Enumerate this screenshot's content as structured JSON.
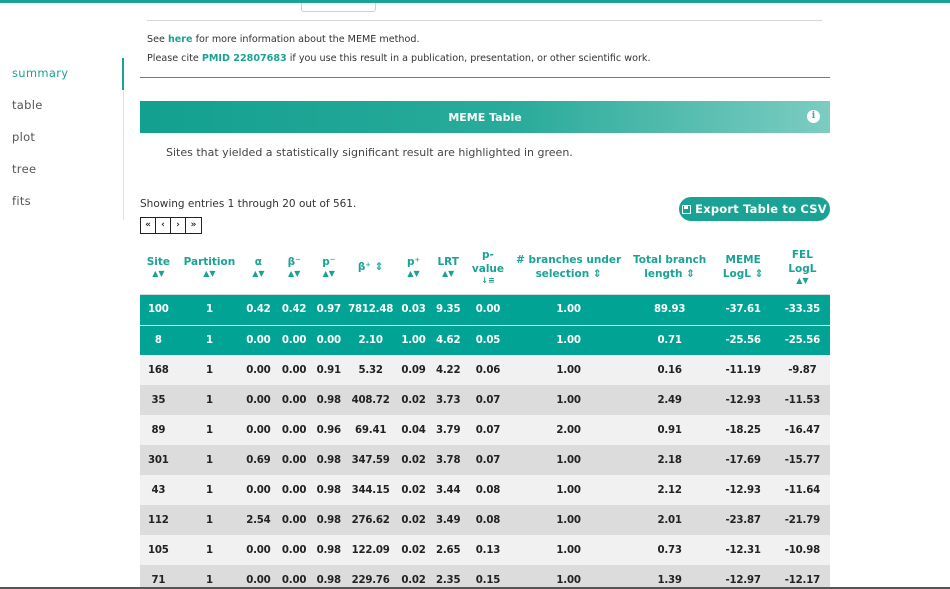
{
  "info": {
    "line1_prefix": "See ",
    "line1_link": "here",
    "line1_suffix": " for more information about the MEME method.",
    "line2_prefix": "Please cite ",
    "line2_link": "PMID 22807683",
    "line2_suffix": " if you use this result in a publication, presentation, or other scientific work."
  },
  "sidebar": {
    "items": [
      {
        "label": "summary",
        "active": true
      },
      {
        "label": "table",
        "active": false
      },
      {
        "label": "plot",
        "active": false
      },
      {
        "label": "tree",
        "active": false
      },
      {
        "label": "fits",
        "active": false
      }
    ]
  },
  "panel": {
    "title": "MEME Table",
    "info_icon": "i",
    "note": "Sites that yielded a statistically significant result are highlighted in green.",
    "showing": "Showing entries 1 through 20 out of 561.",
    "export_label": "Export Table to CSV",
    "pager": [
      "«",
      "‹",
      "›",
      "»"
    ]
  },
  "columns": [
    {
      "label": "Site",
      "sort": "▲▼"
    },
    {
      "label": "Partition",
      "sort": "▲▼"
    },
    {
      "label": "α",
      "sort": "▲▼"
    },
    {
      "label": "β⁻",
      "sort": "▲▼"
    },
    {
      "label": "p⁻",
      "sort": "▲▼"
    },
    {
      "label": "β⁺ ⇕",
      "sort": ""
    },
    {
      "label": "p⁺",
      "sort": "▲▼"
    },
    {
      "label": "LRT",
      "sort": "▲▼"
    },
    {
      "label": "p-value",
      "sort": "↓≡"
    },
    {
      "label": "# branches under selection ⇕",
      "sort": ""
    },
    {
      "label": "Total branch length ⇕",
      "sort": ""
    },
    {
      "label": "MEME LogL ⇕",
      "sort": ""
    },
    {
      "label": "FEL LogL",
      "sort": "▲▼"
    }
  ],
  "rows": [
    {
      "sig": true,
      "cells": [
        "100",
        "1",
        "0.42",
        "0.42",
        "0.97",
        "7812.48",
        "0.03",
        "9.35",
        "0.00",
        "1.00",
        "89.93",
        "-37.61",
        "-33.35"
      ]
    },
    {
      "sig": true,
      "cells": [
        "8",
        "1",
        "0.00",
        "0.00",
        "0.00",
        "2.10",
        "1.00",
        "4.62",
        "0.05",
        "1.00",
        "0.71",
        "-25.56",
        "-25.56"
      ]
    },
    {
      "sig": false,
      "cells": [
        "168",
        "1",
        "0.00",
        "0.00",
        "0.91",
        "5.32",
        "0.09",
        "4.22",
        "0.06",
        "1.00",
        "0.16",
        "-11.19",
        "-9.87"
      ]
    },
    {
      "sig": false,
      "cells": [
        "35",
        "1",
        "0.00",
        "0.00",
        "0.98",
        "408.72",
        "0.02",
        "3.73",
        "0.07",
        "1.00",
        "2.49",
        "-12.93",
        "-11.53"
      ]
    },
    {
      "sig": false,
      "cells": [
        "89",
        "1",
        "0.00",
        "0.00",
        "0.96",
        "69.41",
        "0.04",
        "3.79",
        "0.07",
        "2.00",
        "0.91",
        "-18.25",
        "-16.47"
      ]
    },
    {
      "sig": false,
      "cells": [
        "301",
        "1",
        "0.69",
        "0.00",
        "0.98",
        "347.59",
        "0.02",
        "3.78",
        "0.07",
        "1.00",
        "2.18",
        "-17.69",
        "-15.77"
      ]
    },
    {
      "sig": false,
      "cells": [
        "43",
        "1",
        "0.00",
        "0.00",
        "0.98",
        "344.15",
        "0.02",
        "3.44",
        "0.08",
        "1.00",
        "2.12",
        "-12.93",
        "-11.64"
      ]
    },
    {
      "sig": false,
      "cells": [
        "112",
        "1",
        "2.54",
        "0.00",
        "0.98",
        "276.62",
        "0.02",
        "3.49",
        "0.08",
        "1.00",
        "2.01",
        "-23.87",
        "-21.79"
      ]
    },
    {
      "sig": false,
      "cells": [
        "105",
        "1",
        "0.00",
        "0.00",
        "0.98",
        "122.09",
        "0.02",
        "2.65",
        "0.13",
        "1.00",
        "0.73",
        "-12.31",
        "-10.98"
      ]
    },
    {
      "sig": false,
      "cells": [
        "71",
        "1",
        "0.00",
        "0.00",
        "0.98",
        "229.76",
        "0.02",
        "2.35",
        "0.15",
        "1.00",
        "1.39",
        "-12.97",
        "-12.17"
      ]
    }
  ]
}
